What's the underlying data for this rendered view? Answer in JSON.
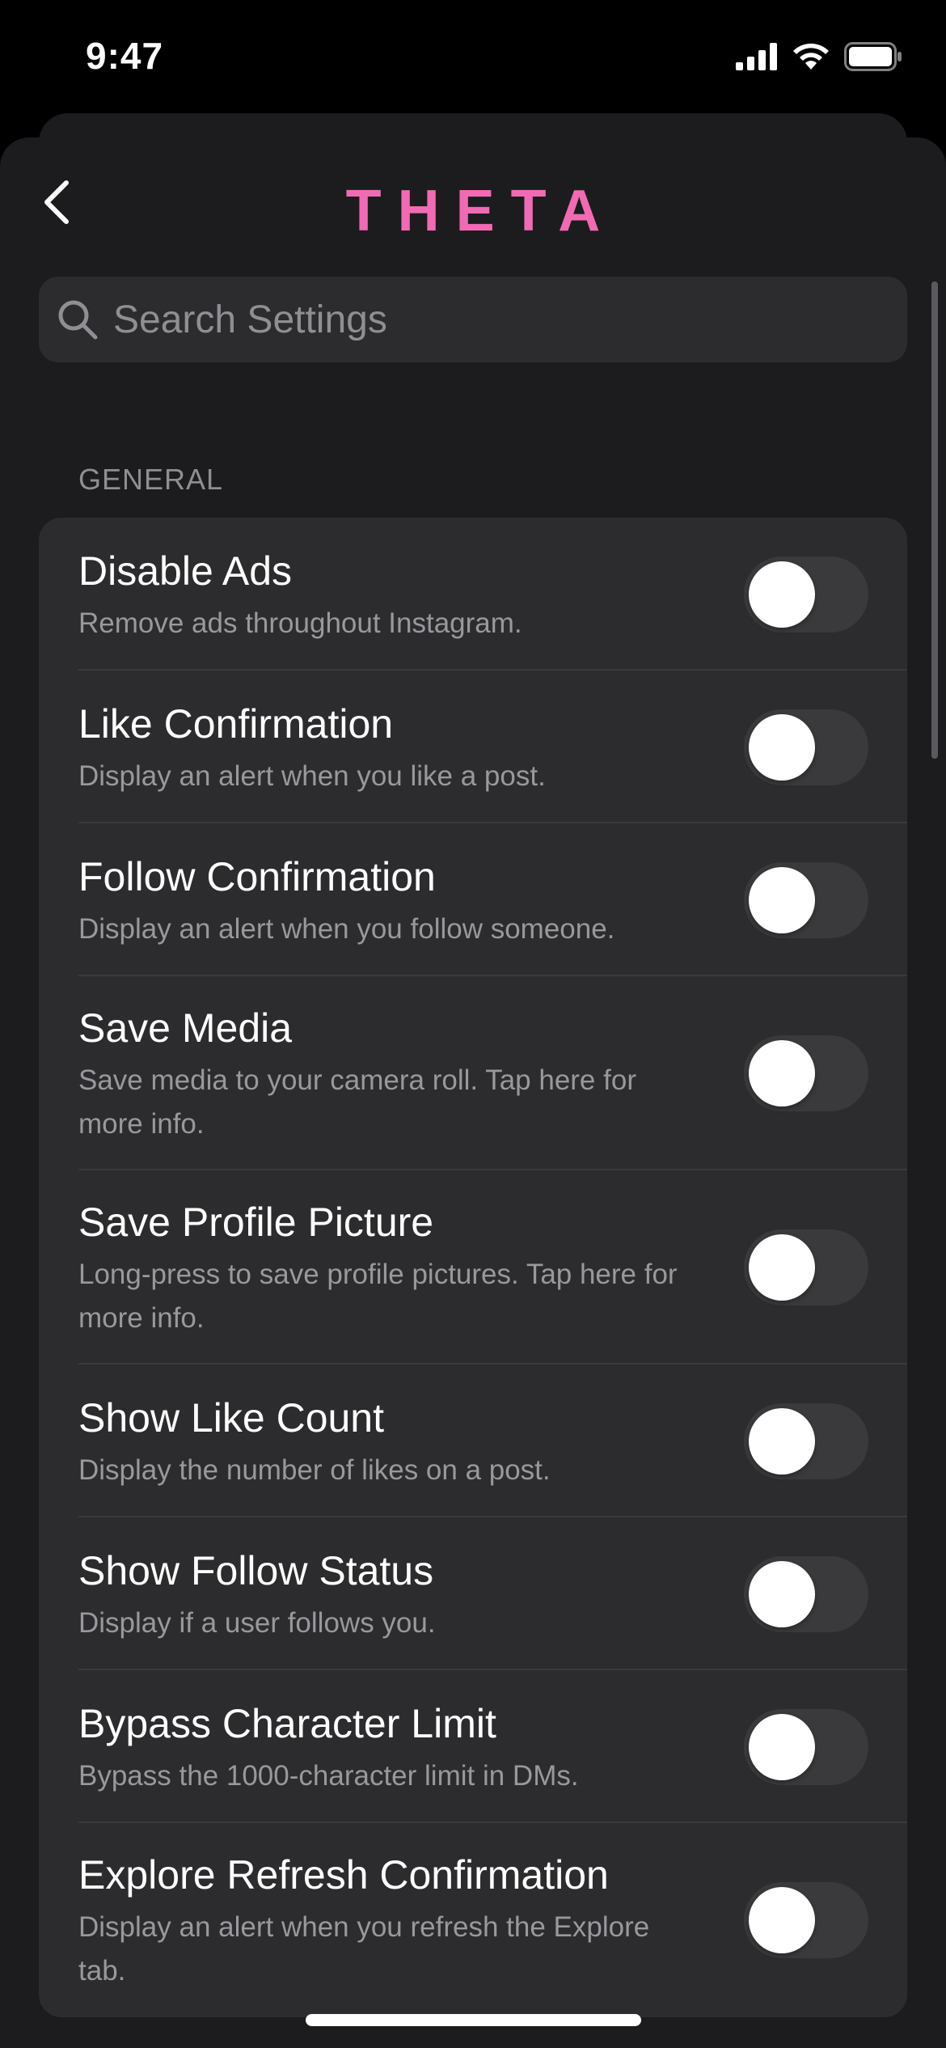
{
  "status_bar": {
    "time": "9:47",
    "icons": [
      "cellular-signal-icon",
      "wifi-icon",
      "battery-icon"
    ]
  },
  "header": {
    "title": "THETA",
    "back_icon": "chevron-left-icon",
    "title_color": "#f06bb3"
  },
  "search": {
    "placeholder": "Search Settings",
    "value": "",
    "icon": "search-icon"
  },
  "section": {
    "header": "GENERAL"
  },
  "settings": [
    {
      "title": "Disable Ads",
      "description": "Remove ads throughout Instagram.",
      "enabled": false
    },
    {
      "title": "Like Confirmation",
      "description": "Display an alert when you like a post.",
      "enabled": false
    },
    {
      "title": "Follow Confirmation",
      "description": "Display an alert when you follow someone.",
      "enabled": false
    },
    {
      "title": "Save Media",
      "description": "Save media to your camera roll. Tap here for more info.",
      "enabled": false
    },
    {
      "title": "Save Profile Picture",
      "description": "Long-press to save profile pictures. Tap here for more info.",
      "enabled": false
    },
    {
      "title": "Show Like Count",
      "description": "Display the number of likes on a post.",
      "enabled": false
    },
    {
      "title": "Show Follow Status",
      "description": "Display if a user follows you.",
      "enabled": false
    },
    {
      "title": "Bypass Character Limit",
      "description": "Bypass the 1000-character limit in DMs.",
      "enabled": false
    },
    {
      "title": "Explore Refresh Confirmation",
      "description": "Display an alert when you refresh the Explore tab.",
      "enabled": false
    }
  ],
  "colors": {
    "background": "#1c1c1e",
    "card": "#2c2c2e",
    "accent": "#f06bb3",
    "toggle_off": "#3a3a3c"
  }
}
